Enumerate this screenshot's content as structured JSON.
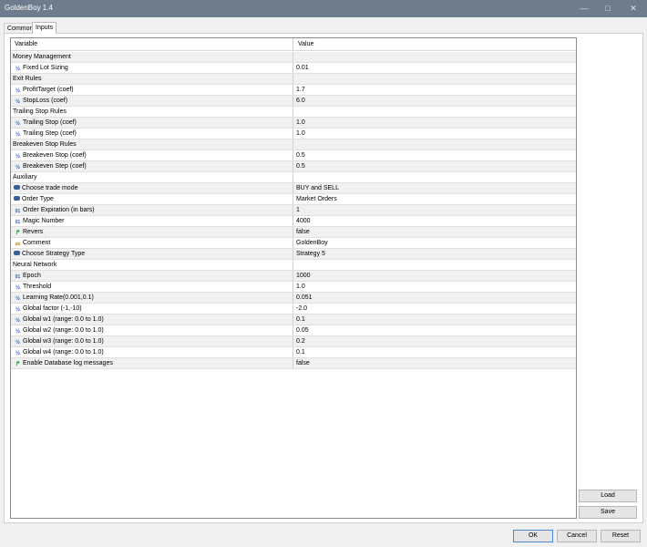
{
  "window": {
    "title": "GoldenBoy 1.4"
  },
  "tabs": [
    "Common",
    "Inputs"
  ],
  "grid": {
    "headers": {
      "variable": "Variable",
      "value": "Value"
    },
    "rows": [
      {
        "kind": "section",
        "label": "Money Management",
        "value": ""
      },
      {
        "kind": "param",
        "icon": "frac",
        "label": "Fixed Lot Sizing",
        "value": "0.01"
      },
      {
        "kind": "section",
        "label": "Exit Rules",
        "value": ""
      },
      {
        "kind": "param",
        "icon": "frac",
        "label": "ProfitTarget (coef)",
        "value": "1.7"
      },
      {
        "kind": "param",
        "icon": "frac",
        "label": "StopLoss (coef)",
        "value": "6.0"
      },
      {
        "kind": "section",
        "label": "Trailing Stop Rules",
        "value": ""
      },
      {
        "kind": "param",
        "icon": "frac",
        "label": "Trailing Stop (coef)",
        "value": "1.0"
      },
      {
        "kind": "param",
        "icon": "frac",
        "label": "Trailing Step (coef)",
        "value": "1.0"
      },
      {
        "kind": "section",
        "label": "Breakeven Stop Rules",
        "value": ""
      },
      {
        "kind": "param",
        "icon": "frac",
        "label": "Breakeven Stop (coef)",
        "value": "0.5"
      },
      {
        "kind": "param",
        "icon": "frac",
        "label": "Breakeven Step (coef)",
        "value": "0.5"
      },
      {
        "kind": "section",
        "label": "Auxiliary",
        "value": ""
      },
      {
        "kind": "param",
        "icon": "enum",
        "label": "Choose trade mode",
        "value": "BUY and SELL"
      },
      {
        "kind": "param",
        "icon": "enum",
        "label": "Order Type",
        "value": "Market Orders"
      },
      {
        "kind": "param",
        "icon": "int",
        "label": "Order Expiration (in bars)",
        "value": "1"
      },
      {
        "kind": "param",
        "icon": "int",
        "label": "Magic Number",
        "value": "4000"
      },
      {
        "kind": "param",
        "icon": "bool",
        "label": "Revers",
        "value": "false"
      },
      {
        "kind": "param",
        "icon": "str",
        "label": "Comment",
        "value": "GoldenBoy"
      },
      {
        "kind": "param",
        "icon": "enum",
        "label": "Choose Strategy Type",
        "value": "Strategy 5"
      },
      {
        "kind": "section",
        "label": "Neural Network",
        "value": ""
      },
      {
        "kind": "param",
        "icon": "int",
        "label": "Epoch",
        "value": "1000"
      },
      {
        "kind": "param",
        "icon": "frac",
        "label": "Threshold",
        "value": "1.0"
      },
      {
        "kind": "param",
        "icon": "frac",
        "label": "Learning Rate(0.001,0.1)",
        "value": "0.051"
      },
      {
        "kind": "param",
        "icon": "frac",
        "label": "Global factor (-1,-10)",
        "value": "-2.0"
      },
      {
        "kind": "param",
        "icon": "frac",
        "label": "Global w1 (range: 0.0 to 1.0)",
        "value": "0.1"
      },
      {
        "kind": "param",
        "icon": "frac",
        "label": "Global w2 (range: 0.0 to 1.0)",
        "value": "0.05"
      },
      {
        "kind": "param",
        "icon": "frac",
        "label": "Global w3 (range: 0.0 to 1.0)",
        "value": "0.2"
      },
      {
        "kind": "param",
        "icon": "frac",
        "label": "Global w4 (range: 0.0 to 1.0)",
        "value": "0.1"
      },
      {
        "kind": "param",
        "icon": "bool",
        "label": "Enable Database log messages",
        "value": "false"
      }
    ]
  },
  "side_buttons": {
    "load": "Load",
    "save": "Save"
  },
  "footer_buttons": {
    "ok": "OK",
    "cancel": "Cancel",
    "reset": "Reset"
  },
  "colors": {
    "titlebar": "#6e7c8c",
    "row_alt": "#f0f0f0",
    "icon_blue": "#2a66b8",
    "icon_green": "#2c9a2c",
    "icon_orange": "#c88b1a"
  }
}
